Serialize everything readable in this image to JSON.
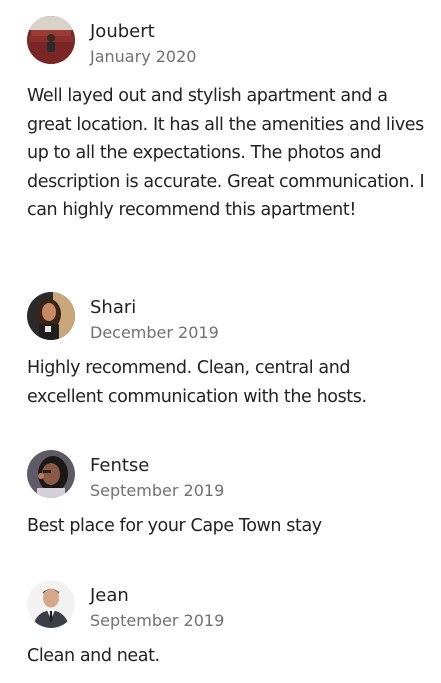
{
  "reviews": [
    {
      "name": "Joubert",
      "date": "January 2020",
      "text": "Well layed out and stylish apartment and a great location. It has all the amenities and lives up to all the expectations. The photos and description is accurate. Great communication. I can highly recommend this apartment!"
    },
    {
      "name": "Shari",
      "date": "December 2019",
      "text": "Highly recommend. Clean, central and excellent communication with the hosts."
    },
    {
      "name": "Fentse",
      "date": "September 2019",
      "text": "Best place for your Cape Town stay"
    },
    {
      "name": "Jean",
      "date": "September 2019",
      "text": "Clean and neat."
    }
  ]
}
